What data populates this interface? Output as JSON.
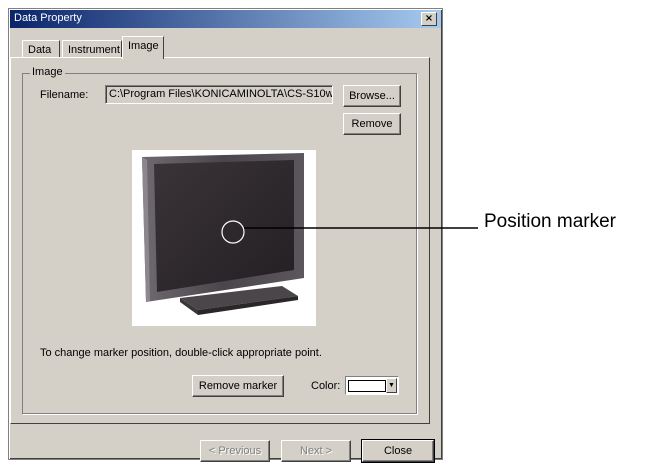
{
  "window": {
    "title": "Data Property",
    "close_glyph": "×"
  },
  "tabs": [
    {
      "label": "Data"
    },
    {
      "label": "Instrument"
    },
    {
      "label": "Image"
    }
  ],
  "image_group": {
    "label": "Image",
    "filename_label": "Filename:",
    "filename_value": "C:\\Program Files\\KONICAMINOLTA\\CS-S10w\\",
    "browse_label": "Browse...",
    "remove_label": "Remove",
    "hint_text": "To change marker position, double-click appropriate point.",
    "remove_marker_label": "Remove marker",
    "color_label": "Color:",
    "color_value": "#ffffff",
    "dropdown_glyph": "▼"
  },
  "footer": {
    "previous_label": "< Previous",
    "next_label": "Next >",
    "close_label": "Close"
  },
  "annotation": {
    "callout_text": "Position marker"
  }
}
